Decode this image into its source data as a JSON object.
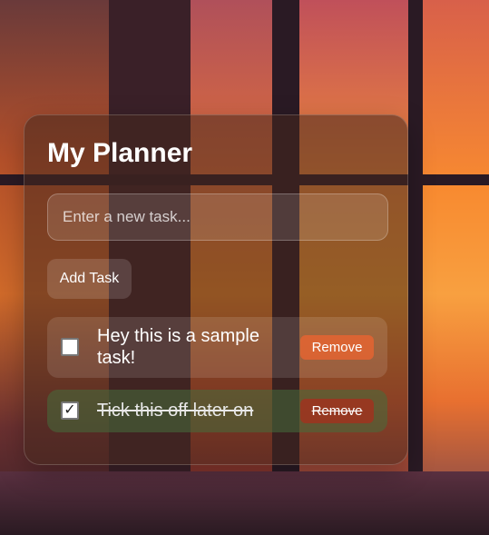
{
  "app": {
    "title": "My Planner"
  },
  "new_task": {
    "placeholder": "Enter a new task...",
    "value": ""
  },
  "add_button": {
    "label": "Add Task"
  },
  "tasks": [
    {
      "text": "Hey this is a sample task!",
      "completed": false,
      "checkbox_glyph": "",
      "remove_label": "Remove"
    },
    {
      "text": "Tick this off later on",
      "completed": true,
      "checkbox_glyph": "✓",
      "remove_label": "Remove"
    }
  ],
  "colors": {
    "accent": "#e06432",
    "completed_bg": "#466e3c",
    "text": "#ffffff"
  }
}
